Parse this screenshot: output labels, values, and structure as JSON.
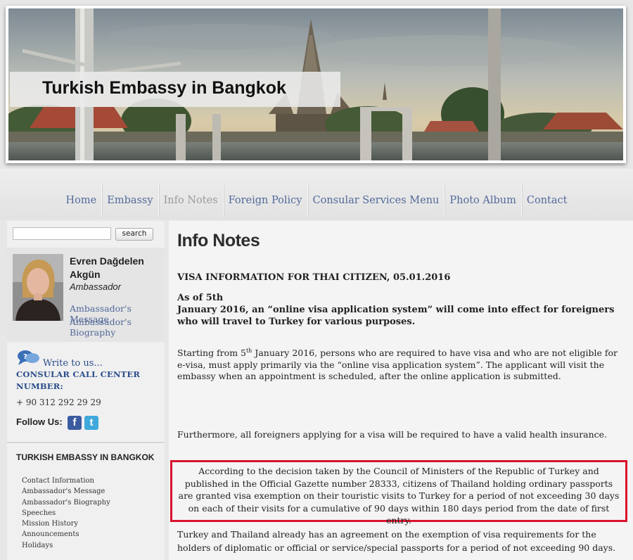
{
  "header": {
    "title": "Turkish Embassy in Bangkok"
  },
  "nav": {
    "items": [
      "Home",
      "Embassy",
      "Info Notes",
      "Foreign Policy",
      "Consular Services Menu",
      "Photo Album",
      "Contact"
    ],
    "active": "Info Notes"
  },
  "sidebar": {
    "search": {
      "value": "",
      "button": "search"
    },
    "ambassador": {
      "name": "Evren Dağdelen Akgün",
      "title": "Ambassador",
      "message_link": "Ambassador's Message",
      "biography_link": "Ambassador's Biography"
    },
    "write_link": "Write to us...",
    "call_center_title": "CONSULAR CALL CENTER NUMBER:",
    "call_center_phone": "+ 90 312 292 29 29",
    "follow_label": "Follow Us:",
    "embassy_title": "TURKISH EMBASSY IN BANGKOK",
    "links": [
      "Contact Information",
      "Ambassador's Message",
      "Ambassador's Biography",
      "Speeches",
      "Mission History",
      "Announcements",
      "Holidays"
    ]
  },
  "main": {
    "title": "Info Notes",
    "visa_heading": "VISA INFORMATION FOR THAI CITIZEN, 05.01.2016",
    "asof_line1": "As of 5th",
    "asof_line2": "January 2016, an “online visa application system” will come into effect for foreigners who will travel to Turkey for various purposes.",
    "para1_before": "Starting from 5",
    "para1_sup": "th",
    "para1_after": " January 2016, persons who are required to have visa and who are not eligible for e-visa, must apply primarily via the “online visa application system”. The applicant will visit the embassy when an appointment is scheduled, after the online application is submitted.",
    "para2": "Furthermore, all foreigners applying for a visa will be required to have a valid health insurance.",
    "highlight": "According to the decision taken by the Council of Ministers of the Republic of Turkey and published in the Official Gazette number 28333, citizens of Thailand holding ordinary passports are granted visa exemption on their touristic visits to Turkey for a period of not exceeding 30 days on each of their visits for a cumulative of 90 days within 180 days period from the date of first entry.",
    "para3": "Turkey and Thailand already has an agreement on the exemption of visa requirements for the holders of diplomatic or official or service/special passports for a period of not exceeding 90 days."
  },
  "colors": {
    "link": "#52699a",
    "nav_active": "#9a9a9a",
    "highlight_border": "#d9132e",
    "facebook": "#3b5ba0",
    "twitter": "#3fa9dc"
  },
  "icons": [
    "speech-bubbles-icon",
    "facebook-icon",
    "twitter-icon"
  ]
}
